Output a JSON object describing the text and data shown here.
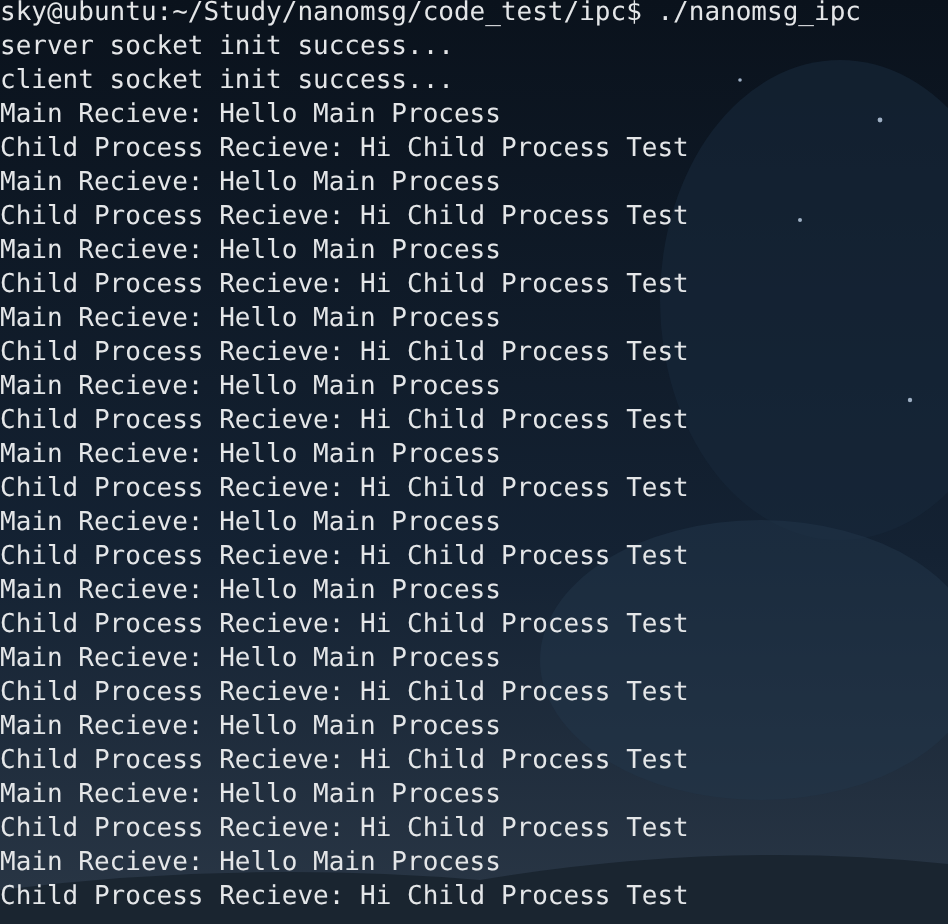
{
  "terminal": {
    "lines": [
      "sky@ubuntu:~/Study/nanomsg/code_test/ipc$ ./nanomsg_ipc",
      "server socket init success...",
      "client socket init success...",
      "Main Recieve: Hello Main Process",
      "Child Process Recieve: Hi Child Process Test",
      "Main Recieve: Hello Main Process",
      "Child Process Recieve: Hi Child Process Test",
      "Main Recieve: Hello Main Process",
      "Child Process Recieve: Hi Child Process Test",
      "Main Recieve: Hello Main Process",
      "Child Process Recieve: Hi Child Process Test",
      "Main Recieve: Hello Main Process",
      "Child Process Recieve: Hi Child Process Test",
      "Main Recieve: Hello Main Process",
      "Child Process Recieve: Hi Child Process Test",
      "Main Recieve: Hello Main Process",
      "Child Process Recieve: Hi Child Process Test",
      "Main Recieve: Hello Main Process",
      "Child Process Recieve: Hi Child Process Test",
      "Main Recieve: Hello Main Process",
      "Child Process Recieve: Hi Child Process Test",
      "Main Recieve: Hello Main Process",
      "Child Process Recieve: Hi Child Process Test",
      "Main Recieve: Hello Main Process",
      "Child Process Recieve: Hi Child Process Test",
      "Main Recieve: Hello Main Process",
      "Child Process Recieve: Hi Child Process Test"
    ]
  }
}
